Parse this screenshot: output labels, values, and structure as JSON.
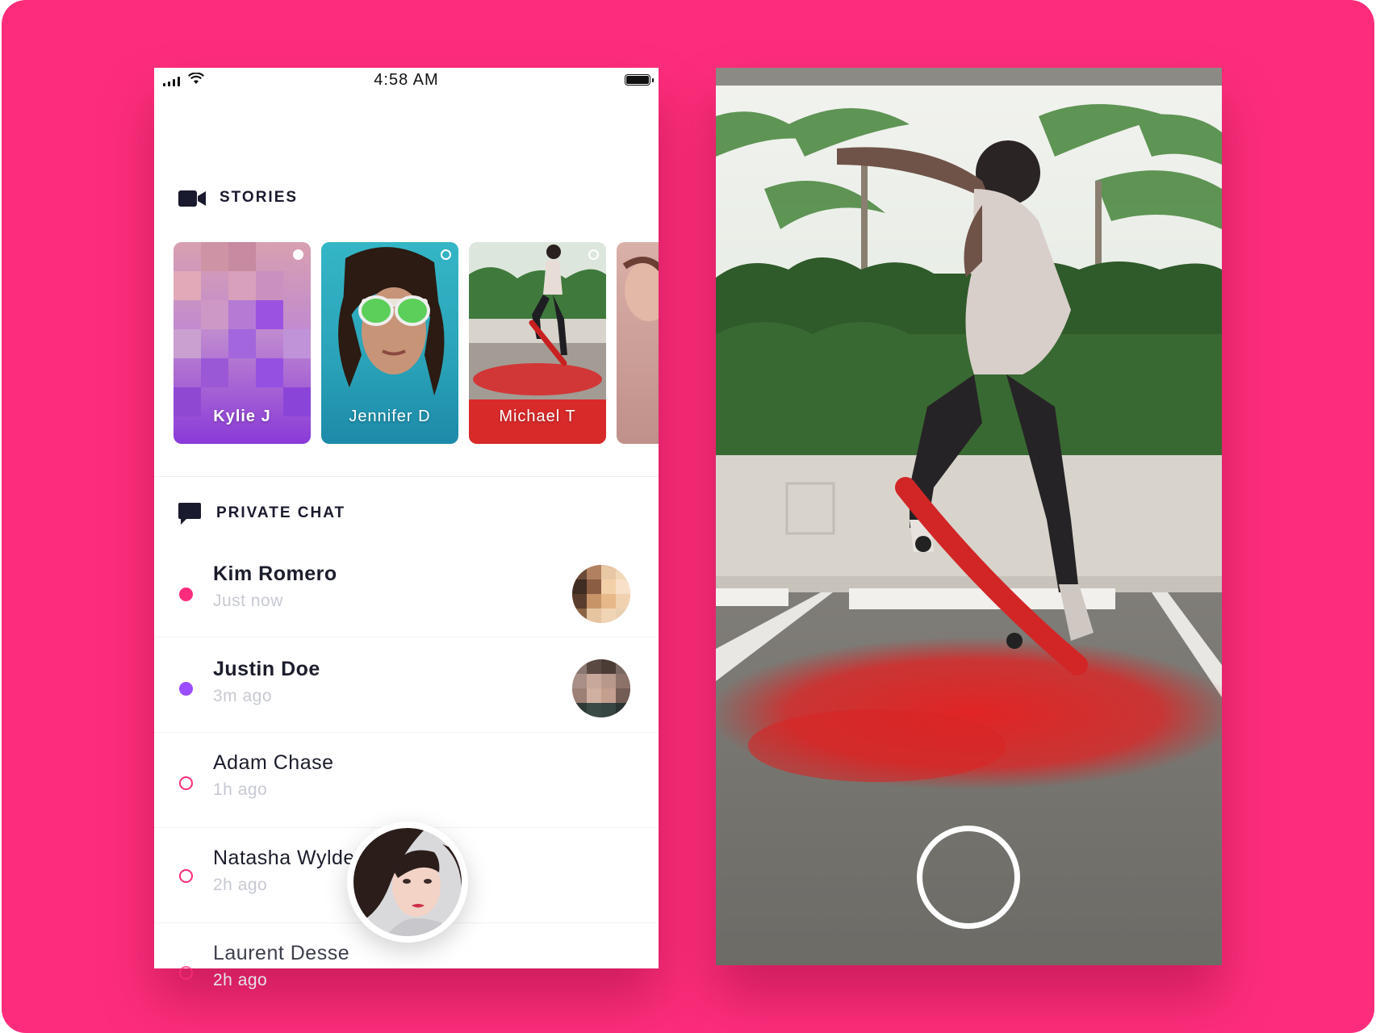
{
  "status_bar": {
    "time": "4:58 AM"
  },
  "stories": {
    "title": "STORIES",
    "items": [
      {
        "name": "Kylie J"
      },
      {
        "name": "Jennifer D"
      },
      {
        "name": "Michael T"
      },
      {
        "name": ""
      }
    ]
  },
  "private_chat": {
    "title": "PRIVATE CHAT",
    "items": [
      {
        "name": "Kim Romero",
        "time": "Just now"
      },
      {
        "name": "Justin Doe",
        "time": "3m ago"
      },
      {
        "name": "Adam Chase",
        "time": "1h ago"
      },
      {
        "name": "Natasha Wylde",
        "time": "2h ago"
      },
      {
        "name": "Laurent Desse",
        "time": "2h ago"
      }
    ]
  },
  "colors": {
    "background": "#fd2d7c",
    "unread_pink": "#fd2d7c",
    "unread_purple": "#9b4dff",
    "title_dark": "#1a1a2e"
  },
  "icons": {
    "stories": "video-camera-icon",
    "private_chat": "chat-bubble-icon",
    "capture": "capture-ring-icon"
  }
}
